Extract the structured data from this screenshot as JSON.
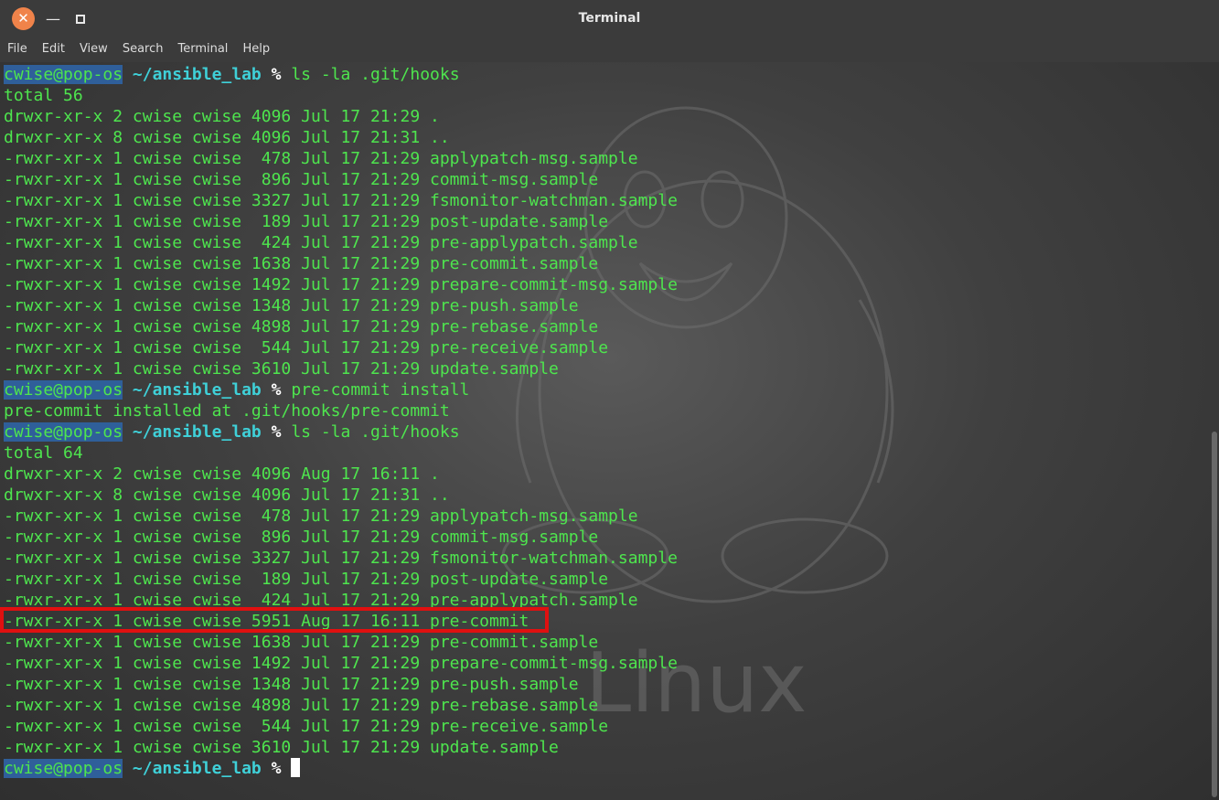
{
  "window": {
    "title": "Terminal",
    "close_glyph": "✕",
    "minimize_glyph": "—"
  },
  "menu": [
    "File",
    "Edit",
    "View",
    "Search",
    "Terminal",
    "Help"
  ],
  "prompt": {
    "userhost": "cwise@pop-os",
    "path": "~/ansible_lab",
    "symbol": "%"
  },
  "terminal_lines": [
    {
      "type": "prompt",
      "cmd": "ls -la .git/hooks"
    },
    {
      "type": "out",
      "text": "total 56"
    },
    {
      "type": "out",
      "text": "drwxr-xr-x 2 cwise cwise 4096 Jul 17 21:29 ."
    },
    {
      "type": "out",
      "text": "drwxr-xr-x 8 cwise cwise 4096 Jul 17 21:31 .."
    },
    {
      "type": "out",
      "text": "-rwxr-xr-x 1 cwise cwise  478 Jul 17 21:29 applypatch-msg.sample"
    },
    {
      "type": "out",
      "text": "-rwxr-xr-x 1 cwise cwise  896 Jul 17 21:29 commit-msg.sample"
    },
    {
      "type": "out",
      "text": "-rwxr-xr-x 1 cwise cwise 3327 Jul 17 21:29 fsmonitor-watchman.sample"
    },
    {
      "type": "out",
      "text": "-rwxr-xr-x 1 cwise cwise  189 Jul 17 21:29 post-update.sample"
    },
    {
      "type": "out",
      "text": "-rwxr-xr-x 1 cwise cwise  424 Jul 17 21:29 pre-applypatch.sample"
    },
    {
      "type": "out",
      "text": "-rwxr-xr-x 1 cwise cwise 1638 Jul 17 21:29 pre-commit.sample"
    },
    {
      "type": "out",
      "text": "-rwxr-xr-x 1 cwise cwise 1492 Jul 17 21:29 prepare-commit-msg.sample"
    },
    {
      "type": "out",
      "text": "-rwxr-xr-x 1 cwise cwise 1348 Jul 17 21:29 pre-push.sample"
    },
    {
      "type": "out",
      "text": "-rwxr-xr-x 1 cwise cwise 4898 Jul 17 21:29 pre-rebase.sample"
    },
    {
      "type": "out",
      "text": "-rwxr-xr-x 1 cwise cwise  544 Jul 17 21:29 pre-receive.sample"
    },
    {
      "type": "out",
      "text": "-rwxr-xr-x 1 cwise cwise 3610 Jul 17 21:29 update.sample"
    },
    {
      "type": "prompt",
      "cmd": "pre-commit install"
    },
    {
      "type": "out",
      "text": "pre-commit installed at .git/hooks/pre-commit"
    },
    {
      "type": "prompt",
      "cmd": "ls -la .git/hooks"
    },
    {
      "type": "out",
      "text": "total 64"
    },
    {
      "type": "out",
      "text": "drwxr-xr-x 2 cwise cwise 4096 Aug 17 16:11 ."
    },
    {
      "type": "out",
      "text": "drwxr-xr-x 8 cwise cwise 4096 Jul 17 21:31 .."
    },
    {
      "type": "out",
      "text": "-rwxr-xr-x 1 cwise cwise  478 Jul 17 21:29 applypatch-msg.sample"
    },
    {
      "type": "out",
      "text": "-rwxr-xr-x 1 cwise cwise  896 Jul 17 21:29 commit-msg.sample"
    },
    {
      "type": "out",
      "text": "-rwxr-xr-x 1 cwise cwise 3327 Jul 17 21:29 fsmonitor-watchman.sample"
    },
    {
      "type": "out",
      "text": "-rwxr-xr-x 1 cwise cwise  189 Jul 17 21:29 post-update.sample"
    },
    {
      "type": "out",
      "text": "-rwxr-xr-x 1 cwise cwise  424 Jul 17 21:29 pre-applypatch.sample"
    },
    {
      "type": "out",
      "text": "-rwxr-xr-x 1 cwise cwise 5951 Aug 17 16:11 pre-commit",
      "highlight": true
    },
    {
      "type": "out",
      "text": "-rwxr-xr-x 1 cwise cwise 1638 Jul 17 21:29 pre-commit.sample"
    },
    {
      "type": "out",
      "text": "-rwxr-xr-x 1 cwise cwise 1492 Jul 17 21:29 prepare-commit-msg.sample"
    },
    {
      "type": "out",
      "text": "-rwxr-xr-x 1 cwise cwise 1348 Jul 17 21:29 pre-push.sample"
    },
    {
      "type": "out",
      "text": "-rwxr-xr-x 1 cwise cwise 4898 Jul 17 21:29 pre-rebase.sample"
    },
    {
      "type": "out",
      "text": "-rwxr-xr-x 1 cwise cwise  544 Jul 17 21:29 pre-receive.sample"
    },
    {
      "type": "out",
      "text": "-rwxr-xr-x 1 cwise cwise 3610 Jul 17 21:29 update.sample"
    },
    {
      "type": "prompt",
      "cmd": "",
      "cursor": true
    }
  ],
  "background": {
    "watermark_text": "Linux",
    "watermark_icon": "tux-penguin-icon"
  },
  "colors": {
    "text_green": "#4ee54e",
    "path_cyan": "#3fd0d8",
    "userhost_bg": "#2f5f9a",
    "highlight_red": "#e01010",
    "close_orange": "#f0834a"
  }
}
